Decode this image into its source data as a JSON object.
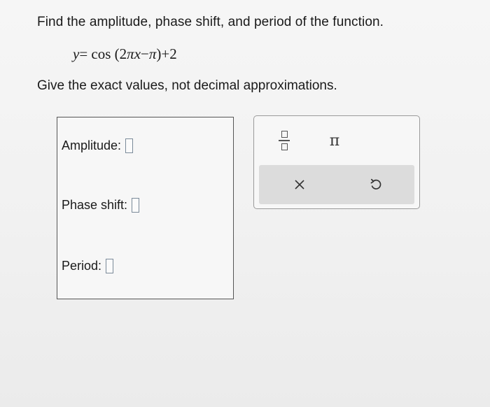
{
  "question": {
    "prompt": "Find the amplitude, phase shift, and period of the function.",
    "equation": {
      "y": "y",
      "equals": "=",
      "func": "cos",
      "open": "(2",
      "pi1": "π",
      "x": "x",
      "minus": "−",
      "pi2": "π",
      "close": ")",
      "plus": "+",
      "const": "2"
    },
    "instruction": "Give the exact values, not decimal approximations."
  },
  "answers": {
    "amplitude_label": "Amplitude:",
    "amplitude_value": "",
    "phase_shift_label": "Phase shift:",
    "phase_shift_value": "",
    "period_label": "Period:",
    "period_value": ""
  },
  "toolbar": {
    "fraction_icon": "fraction-template-icon",
    "pi_symbol": "π",
    "clear_symbol": "✕",
    "undo_icon": "undo-icon"
  },
  "colors": {
    "answer_box_border": "#7a8a99",
    "action_bar_bg": "#dcdcdc"
  }
}
